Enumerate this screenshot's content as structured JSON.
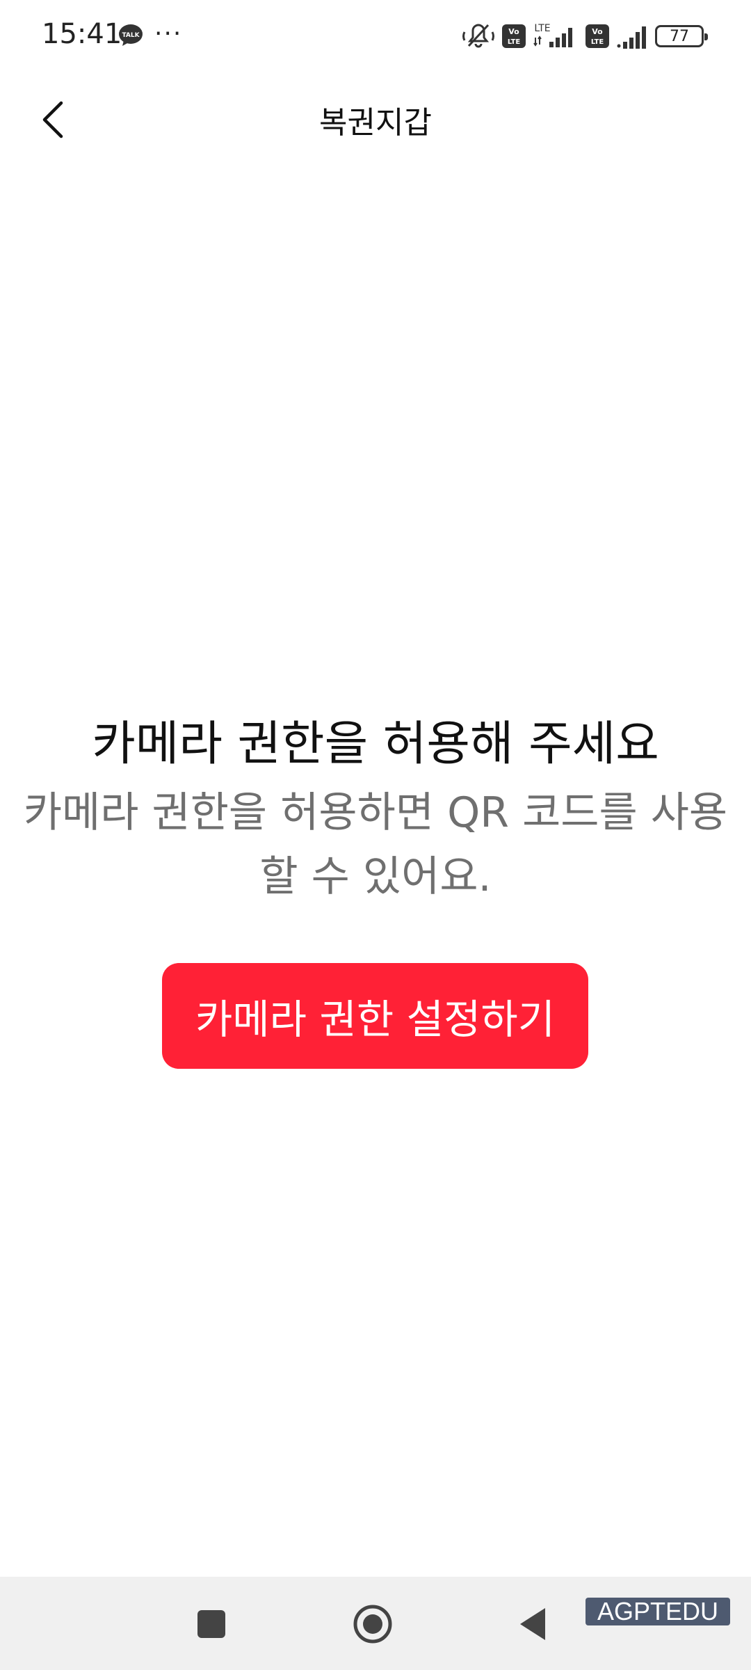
{
  "status_bar": {
    "time": "15:41",
    "talk_badge": "TALK",
    "more_dots": "···",
    "volte_1": "Vo LTE",
    "lte_label": "LTE",
    "volte_2": "Vo LTE",
    "battery": "77"
  },
  "header": {
    "title": "복권지갑",
    "back_icon": "chevron-left-icon"
  },
  "main": {
    "headline": "카메라 권한을 허용해 주세요",
    "description": "카메라 권한을 허용하면 QR 코드를 사용할 수 있어요.",
    "button_label": "카메라 권한 설정하기",
    "button_color": "#ff2136"
  },
  "nav_bar": {
    "recent_icon": "square-icon",
    "home_icon": "circle-icon",
    "back_icon": "triangle-back-icon"
  },
  "watermark": "AGPTEDU"
}
